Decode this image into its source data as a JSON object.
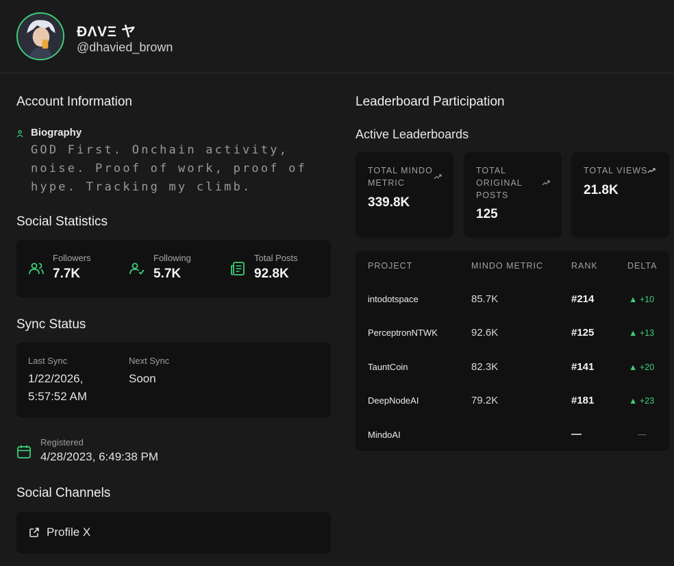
{
  "profile": {
    "display_name": "ĐΛVΞ ヤ",
    "handle": "@dhavied_brown"
  },
  "account": {
    "title": "Account Information",
    "bio_label": "Biography",
    "bio_text": "GOD First. Onchain activity, noise. Proof of work, proof of hype. Tracking my climb."
  },
  "social_stats": {
    "title": "Social Statistics",
    "items": [
      {
        "label": "Followers",
        "value": "7.7K",
        "icon": "users-icon"
      },
      {
        "label": "Following",
        "value": "5.7K",
        "icon": "user-check-icon"
      },
      {
        "label": "Total Posts",
        "value": "92.8K",
        "icon": "newspaper-icon"
      }
    ]
  },
  "sync": {
    "title": "Sync Status",
    "last_label": "Last Sync",
    "last_value_line1": "1/22/2026,",
    "last_value_line2": "5:57:52 AM",
    "next_label": "Next Sync",
    "next_value": "Soon"
  },
  "registered": {
    "label": "Registered",
    "value": "4/28/2023, 6:49:38 PM"
  },
  "channels": {
    "title": "Social Channels",
    "items": [
      {
        "label": "Profile X",
        "icon": "external-link-icon"
      }
    ]
  },
  "leaderboard": {
    "title": "Leaderboard Participation",
    "active_title": "Active Leaderboards",
    "metrics": [
      {
        "label_lines": [
          "TOTAL MINDO",
          "METRIC"
        ],
        "value": "339.8K"
      },
      {
        "label_lines": [
          "TOTAL",
          "ORIGINAL",
          "POSTS"
        ],
        "value": "125"
      },
      {
        "label_lines": [
          "TOTAL VIEWS"
        ],
        "value": "21.8K"
      }
    ],
    "columns": [
      "PROJECT",
      "MINDO METRIC",
      "RANK",
      "DELTA"
    ],
    "rows": [
      {
        "project": "intodotspace",
        "metric": "85.7K",
        "rank": "#214",
        "delta": "▲ +10"
      },
      {
        "project": "PerceptronNTWK",
        "metric": "92.6K",
        "rank": "#125",
        "delta": "▲ +13"
      },
      {
        "project": "TauntCoin",
        "metric": "82.3K",
        "rank": "#141",
        "delta": "▲ +20"
      },
      {
        "project": "DeepNodeAI",
        "metric": "79.2K",
        "rank": "#181",
        "delta": "▲ +23"
      },
      {
        "project": "MindoAI",
        "metric": "",
        "rank": "—",
        "delta": "—"
      }
    ]
  },
  "colors": {
    "accent": "#3ecf7a",
    "background": "#1a1a1a",
    "card": "#111111"
  }
}
